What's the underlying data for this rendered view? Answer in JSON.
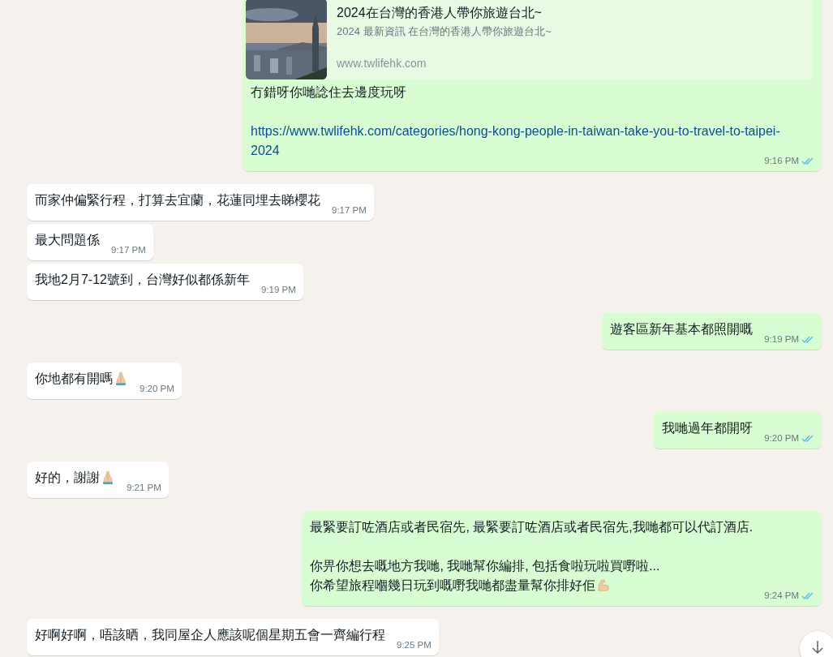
{
  "messages": [
    {
      "outgoing": true,
      "preview": {
        "kind": "picture",
        "title": "2024在台灣的香港人帶你旅遊台北~",
        "description": "2024 最新資訊 在台灣的香港人帶你旅遊台北~",
        "domain": "www.twlifehk.com"
      },
      "paragraphs": [
        [
          "冇錯呀你哋諗住去邊度玩呀"
        ]
      ],
      "link": "https://www.twlifehk.com/categories/hong-kong-people-in-taiwan-take-you-to-travel-to-taipei-2024",
      "time": "9:16 PM",
      "read": true
    },
    {
      "outgoing": false,
      "paragraphs": [
        [
          "而家仲偏緊行程，打算去宜蘭，花蓮同埋去睇櫻花"
        ]
      ],
      "time": "9:17 PM"
    },
    {
      "outgoing": false,
      "paragraphs": [
        [
          "最大問題係"
        ]
      ],
      "time": "9:17 PM"
    },
    {
      "outgoing": false,
      "paragraphs": [
        [
          "我地2月7-12號到，台灣好似都係新年"
        ]
      ],
      "time": "9:19 PM"
    },
    {
      "outgoing": true,
      "paragraphs": [
        [
          "遊客區新年基本都照開嘅"
        ]
      ],
      "time": "9:19 PM",
      "read": true
    },
    {
      "outgoing": false,
      "paragraphs": [
        [
          "你地都有開嗎"
        ]
      ],
      "praying_hands": true,
      "time": "9:20 PM"
    },
    {
      "outgoing": true,
      "paragraphs": [
        [
          "我哋過年都開呀"
        ]
      ],
      "time": "9:20 PM",
      "read": true
    },
    {
      "outgoing": false,
      "paragraphs": [
        [
          "好的，謝謝"
        ]
      ],
      "praying_hands": true,
      "time": "9:21 PM"
    },
    {
      "outgoing": true,
      "paragraphs": [
        [
          "最緊要訂咗酒店或者民宿先, 最緊要訂咗酒店或者民宿先,我哋都可以代訂酒店."
        ],
        [
          "你畀你想去嘅地方我哋, 我哋幫你編排, 包括食啦玩啦買嘢啦...",
          "你希望旅程嗰幾日玩到嘅嘢我哋都盡量幫你排好佢"
        ]
      ],
      "flexed_arm": true,
      "time": "9:24 PM",
      "read": true
    },
    {
      "outgoing": false,
      "paragraphs": [
        [
          "好啊好啊，唔該晒，我同屋企人應該呢個星期五會一齊編行程"
        ]
      ],
      "time": "9:25 PM"
    }
  ],
  "scroll_button": {
    "visible": true
  }
}
